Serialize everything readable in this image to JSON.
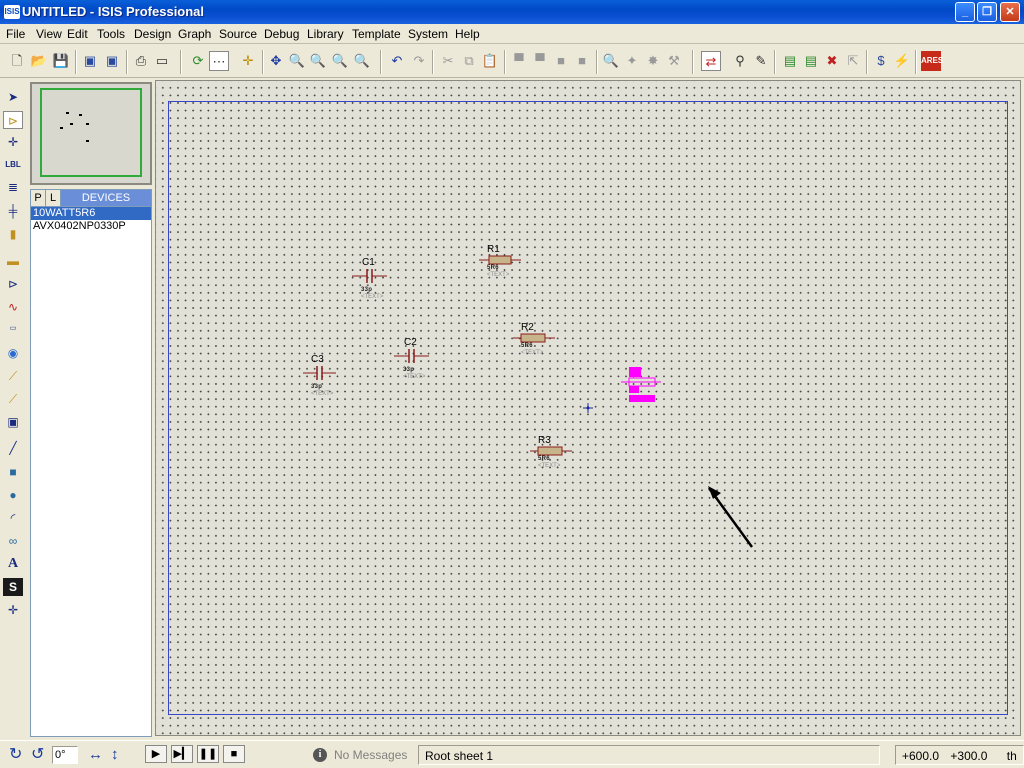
{
  "window": {
    "app_icon": "ISIS",
    "title": "UNTITLED - ISIS Professional"
  },
  "menu": [
    "File",
    "View",
    "Edit",
    "Tools",
    "Design",
    "Graph",
    "Source",
    "Debug",
    "Library",
    "Template",
    "System",
    "Help"
  ],
  "overview": {
    "frame_color": "#2eab3a"
  },
  "devices": {
    "tab_p": "P",
    "tab_l": "L",
    "header": "DEVICES",
    "items": [
      "10WATT5R6",
      "AVX0402NP0330P"
    ],
    "selected_index": 0
  },
  "schematic": {
    "sheet_border_color": "#3a46c8",
    "component_color": "#8b1a1a",
    "selected_color": "#ff00ff",
    "capacitors": [
      {
        "ref": "C1",
        "value": "33p",
        "text": "<TEXT>"
      },
      {
        "ref": "C2",
        "value": "33p",
        "text": "<TEXT>"
      },
      {
        "ref": "C3",
        "value": "33p",
        "text": "<TEXT>"
      }
    ],
    "resistors": [
      {
        "ref": "R1",
        "value": "5R6",
        "text": "<TEXT>"
      },
      {
        "ref": "R2",
        "value": "5R6",
        "text": "<TEXT>"
      },
      {
        "ref": "R3",
        "value": "5R6",
        "text": "<TEXT>"
      }
    ]
  },
  "status": {
    "rotation": "0°",
    "messages": "No Messages",
    "sheet": "Root sheet 1",
    "coord_x": "+600.0",
    "coord_y": "+300.0",
    "units": "th"
  }
}
